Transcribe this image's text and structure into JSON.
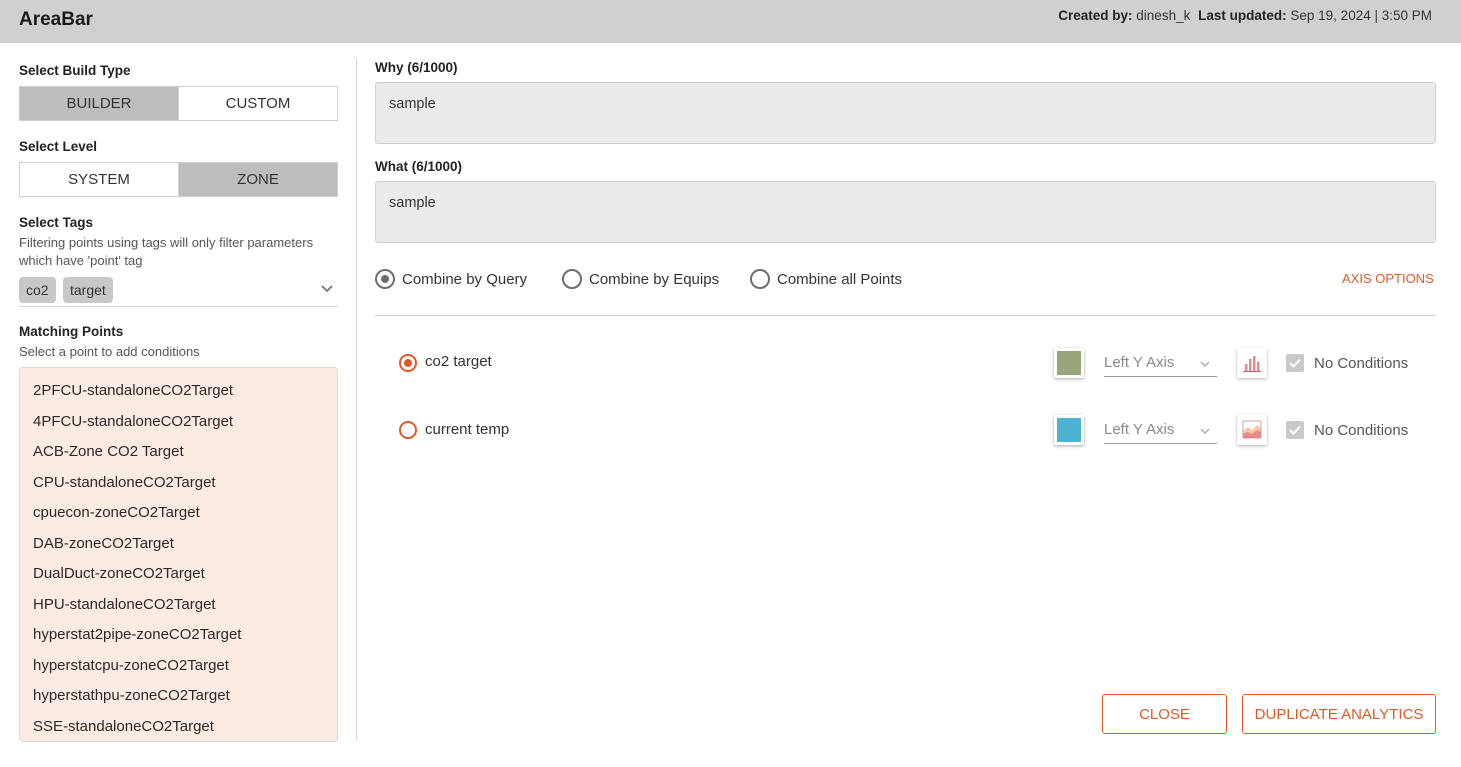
{
  "header": {
    "title": "AreaBar",
    "created_by_label": "Created by:",
    "created_by": "dinesh_k",
    "last_updated_label": "Last updated:",
    "last_updated": "Sep 19, 2024 | 3:50 PM"
  },
  "build_type": {
    "label": "Select Build Type",
    "options": [
      "BUILDER",
      "CUSTOM"
    ],
    "selected": "BUILDER"
  },
  "level": {
    "label": "Select Level",
    "options": [
      "SYSTEM",
      "ZONE"
    ],
    "selected": "ZONE"
  },
  "tags": {
    "label": "Select Tags",
    "help": "Filtering points using tags will only filter parameters which have 'point' tag",
    "selected": [
      "co2",
      "target"
    ]
  },
  "matching_points": {
    "label": "Matching Points",
    "help": "Select a point to add conditions",
    "items": [
      "2PFCU-standaloneCO2Target",
      "4PFCU-standaloneCO2Target",
      "ACB-Zone CO2 Target",
      "CPU-standaloneCO2Target",
      "cpuecon-zoneCO2Target",
      "DAB-zoneCO2Target",
      "DualDuct-zoneCO2Target",
      "HPU-standaloneCO2Target",
      "hyperstat2pipe-zoneCO2Target",
      "hyperstatcpu-zoneCO2Target",
      "hyperstathpu-zoneCO2Target",
      "SSE-standaloneCO2Target"
    ]
  },
  "why": {
    "label": "Why (6/1000)",
    "value": "sample"
  },
  "what": {
    "label": "What (6/1000)",
    "value": "sample"
  },
  "combine": {
    "options": [
      "Combine by Query",
      "Combine by Equips",
      "Combine all Points"
    ],
    "selected": "Combine by Query"
  },
  "axis_options_label": "AXIS OPTIONS",
  "series": [
    {
      "name": "co2 target",
      "selected": true,
      "color": "#98a57a",
      "axis": "Left Y Axis",
      "chart_icon": "bar-chart-icon",
      "conditions": "No Conditions"
    },
    {
      "name": "current temp",
      "selected": false,
      "color": "#4eb3d3",
      "axis": "Left Y Axis",
      "chart_icon": "area-chart-icon",
      "conditions": "No Conditions"
    }
  ],
  "buttons": {
    "close": "CLOSE",
    "duplicate": "DUPLICATE ANALYTICS"
  },
  "colors": {
    "accent": "#e05a28",
    "header_bg": "#d0d0d0",
    "points_bg": "#fcebe3"
  }
}
